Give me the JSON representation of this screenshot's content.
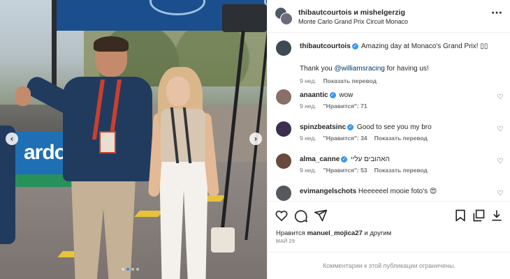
{
  "photo": {
    "ad_text": "ardo",
    "prev_glyph": "‹",
    "next_glyph": "›",
    "dots_count": 4,
    "active_dot": 1
  },
  "header": {
    "title": "thibautcourtois и mishelgerzig",
    "location": "Monte Carlo Grand Prix Circuit Monaco",
    "more_glyph": "···"
  },
  "caption": {
    "user": "thibautcourtois",
    "text": " Amazing day at Monaco's Grand Prix! ",
    "emoji": "▯▯",
    "line2_prefix": "Thank you ",
    "mention": "@williamsracing",
    "line2_suffix": " for having us!",
    "time": "9 нед.",
    "translate": "Показать перевод"
  },
  "comments": [
    {
      "user": "anaantic",
      "verified": true,
      "text": " wow",
      "time": "9 нед.",
      "likes": "\"Нравится\": 71",
      "translate": ""
    },
    {
      "user": "spinzbeatsinc",
      "verified": true,
      "text": " Good to see you my bro",
      "time": "9 нед.",
      "likes": "\"Нравится\": 34",
      "translate": "Показать перевод"
    },
    {
      "user": "alma_canne",
      "verified": true,
      "text": " האהובים עליי",
      "time": "9 нед.",
      "likes": "\"Нравится\": 53",
      "translate": "Показать перевод"
    },
    {
      "user": "evimangelschots",
      "verified": false,
      "text": " Heeeeeel mooie foto's 😍",
      "time": "",
      "likes": "",
      "translate": ""
    }
  ],
  "actions": {
    "likes_prefix": "Нравится ",
    "likes_user": "manuel_mojica27",
    "likes_suffix": " и другим",
    "date": "МАЙ 29"
  },
  "footer": {
    "text": "Комментарии к этой публикации ограничены."
  },
  "colors": {
    "verified": "#3897f0",
    "mention": "#00376b",
    "meta": "#737373"
  }
}
